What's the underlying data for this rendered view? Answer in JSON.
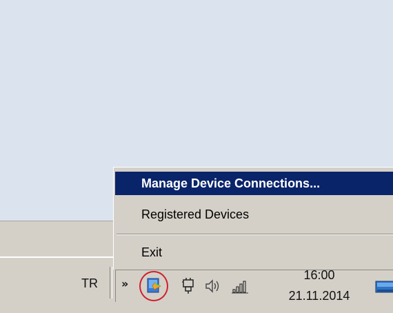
{
  "context_menu": {
    "items": [
      {
        "label": "Manage Device Connections...",
        "highlighted": true
      },
      {
        "label": "Registered Devices",
        "highlighted": false
      },
      {
        "label": "Exit",
        "highlighted": false
      }
    ]
  },
  "taskbar": {
    "language": "TR",
    "tray": {
      "expand_glyph": "»",
      "icons": [
        "device-manager-icon",
        "plug-icon",
        "speaker-icon",
        "signal-icon",
        "show-desktop-icon"
      ],
      "highlight_color": "#d0202a"
    },
    "clock": {
      "time": "16:00",
      "date": "21.11.2014"
    }
  },
  "colors": {
    "menu_highlight": "#0a246a",
    "chrome": "#d4d0c8",
    "desktop": "#dbe3ef"
  }
}
